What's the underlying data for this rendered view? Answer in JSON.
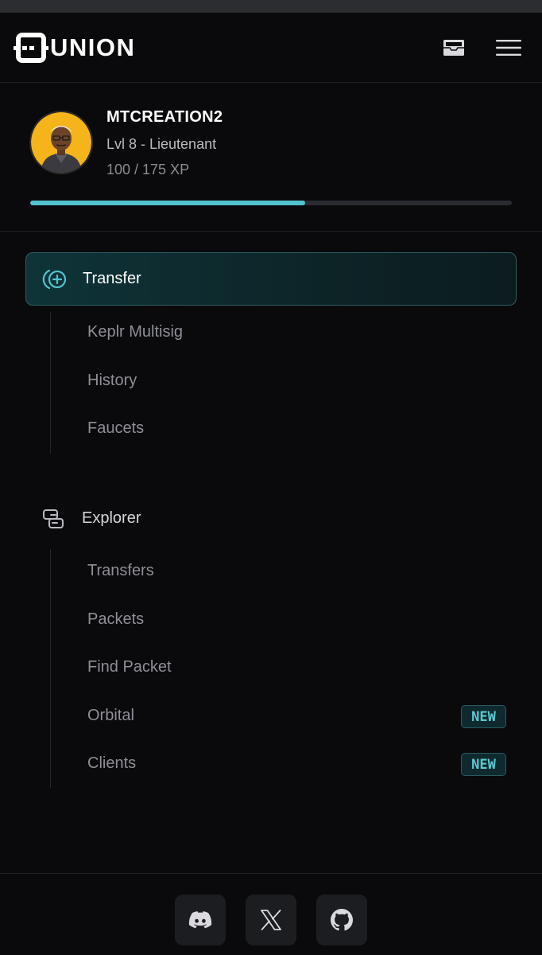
{
  "app": {
    "brand": "UNION"
  },
  "header": {
    "icons": [
      "inbox-icon",
      "hamburger-menu-icon"
    ]
  },
  "profile": {
    "username": "MTCREATION2",
    "level": "Lvl 8 - Lieutenant",
    "xp_text": "100 / 175 XP",
    "xp_progress": 0.571
  },
  "nav": {
    "transfer": {
      "label": "Transfer",
      "icon": "transfer-icon",
      "items": [
        {
          "label": "Keplr Multisig"
        },
        {
          "label": "History"
        },
        {
          "label": "Faucets"
        }
      ]
    },
    "explorer": {
      "label": "Explorer",
      "icon": "explorer-icon",
      "items": [
        {
          "label": "Transfers"
        },
        {
          "label": "Packets"
        },
        {
          "label": "Find Packet"
        },
        {
          "label": "Orbital",
          "badge": "NEW"
        },
        {
          "label": "Clients",
          "badge": "NEW"
        }
      ]
    }
  },
  "footer": {
    "socials": [
      "discord-icon",
      "x-icon",
      "github-icon"
    ]
  },
  "colors": {
    "background": "#0a0a0c",
    "accent": "#52c3cf",
    "badge_text": "#5fc8d4"
  }
}
